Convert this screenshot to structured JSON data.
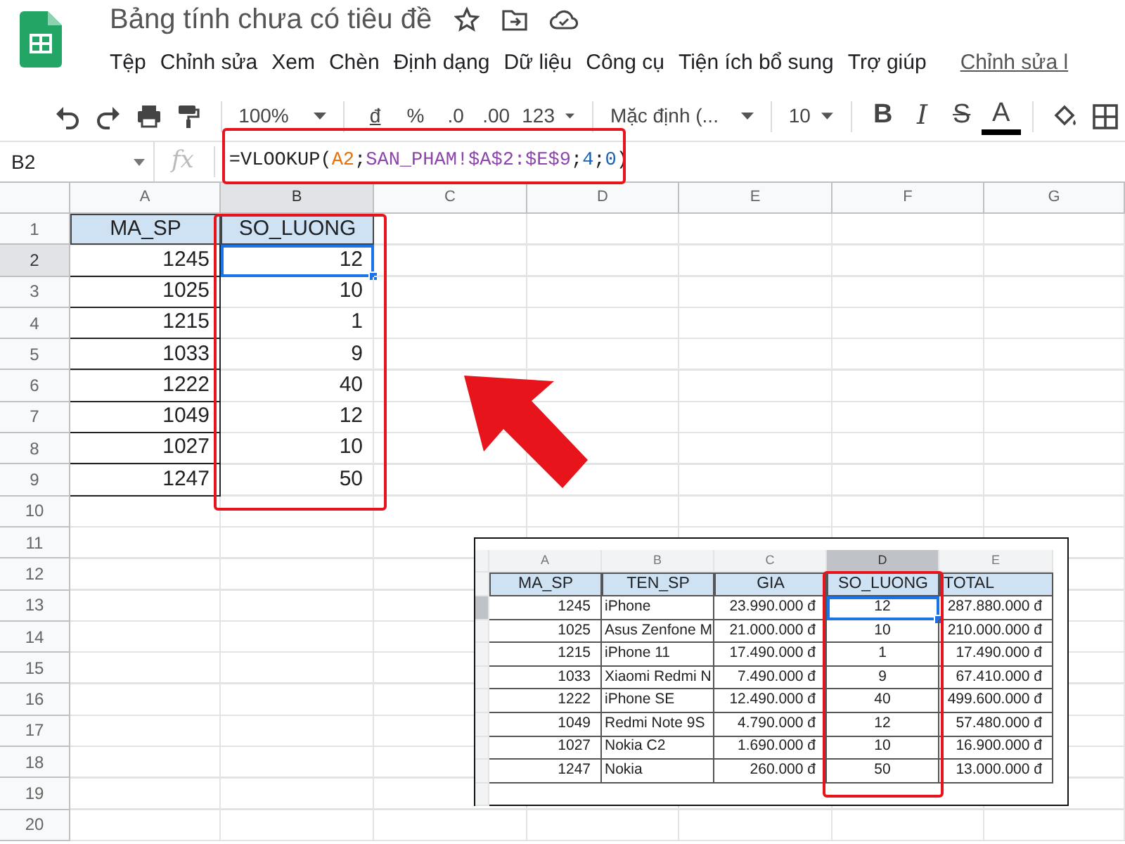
{
  "app": {
    "title": "Bảng tính chưa có tiêu đề",
    "menu": [
      "Tệp",
      "Chỉnh sửa",
      "Xem",
      "Chèn",
      "Định dạng",
      "Dữ liệu",
      "Công cụ",
      "Tiện ích bổ sung",
      "Trợ giúp"
    ],
    "last_edit": "Chỉnh sửa l"
  },
  "toolbar": [
    {
      "kind": "undo"
    },
    {
      "kind": "redo"
    },
    {
      "kind": "print"
    },
    {
      "kind": "paint"
    },
    {
      "kind": "sep"
    },
    {
      "kind": "dropdown",
      "text": "100%"
    },
    {
      "kind": "sep"
    },
    {
      "kind": "text",
      "text": "đ"
    },
    {
      "kind": "text",
      "text": "%"
    },
    {
      "kind": "text",
      "text": ".0"
    },
    {
      "kind": "text",
      "text": ".00"
    },
    {
      "kind": "dropdown",
      "text": "123"
    },
    {
      "kind": "sep"
    },
    {
      "kind": "dropdown",
      "text": "Mặc định (..."
    },
    {
      "kind": "sep"
    },
    {
      "kind": "dropdown",
      "text": "10"
    },
    {
      "kind": "sep"
    },
    {
      "kind": "bold",
      "text": "B"
    },
    {
      "kind": "italic",
      "text": "I"
    },
    {
      "kind": "strike",
      "text": "S"
    },
    {
      "kind": "color",
      "text": "A"
    },
    {
      "kind": "sep"
    },
    {
      "kind": "fill"
    },
    {
      "kind": "borders"
    }
  ],
  "formula_bar": {
    "cell": "B2",
    "fx": "fx",
    "tokens": [
      {
        "text": "=VLOOKUP(",
        "color": "#202124"
      },
      {
        "text": "A2",
        "color": "#e8710a"
      },
      {
        "text": ";",
        "color": "#202124"
      },
      {
        "text": "SAN_PHAM!$A$2:$E$9",
        "color": "#8e44ad"
      },
      {
        "text": ";",
        "color": "#202124"
      },
      {
        "text": "4",
        "color": "#1a5fb4"
      },
      {
        "text": ";",
        "color": "#202124"
      },
      {
        "text": "0",
        "color": "#1a5fb4"
      },
      {
        "text": ")",
        "color": "#202124"
      }
    ]
  },
  "sheet": {
    "columns": [
      {
        "label": "A",
        "selected": false
      },
      {
        "label": "B",
        "selected": true
      },
      {
        "label": "C",
        "selected": false
      },
      {
        "label": "D",
        "selected": false
      },
      {
        "label": "E",
        "selected": false
      },
      {
        "label": "F",
        "selected": false
      },
      {
        "label": "G",
        "selected": false
      }
    ],
    "rows": [
      {
        "number": "1",
        "kind": "header",
        "selected": false,
        "cells": [
          "MA_SP",
          "SO_LUONG"
        ]
      },
      {
        "number": "2",
        "kind": "data",
        "selected": true,
        "cells": [
          "1245",
          "12"
        ]
      },
      {
        "number": "3",
        "kind": "data",
        "selected": false,
        "cells": [
          "1025",
          "10"
        ]
      },
      {
        "number": "4",
        "kind": "data",
        "selected": false,
        "cells": [
          "1215",
          "1"
        ]
      },
      {
        "number": "5",
        "kind": "data",
        "selected": false,
        "cells": [
          "1033",
          "9"
        ]
      },
      {
        "number": "6",
        "kind": "data",
        "selected": false,
        "cells": [
          "1222",
          "40"
        ]
      },
      {
        "number": "7",
        "kind": "data",
        "selected": false,
        "cells": [
          "1049",
          "12"
        ]
      },
      {
        "number": "8",
        "kind": "data",
        "selected": false,
        "cells": [
          "1027",
          "10"
        ]
      },
      {
        "number": "9",
        "kind": "data",
        "selected": false,
        "cells": [
          "1247",
          "50"
        ]
      },
      {
        "number": "10",
        "kind": "empty",
        "selected": false
      },
      {
        "number": "11",
        "kind": "empty",
        "selected": false
      },
      {
        "number": "12",
        "kind": "empty",
        "selected": false
      },
      {
        "number": "13",
        "kind": "empty",
        "selected": false
      },
      {
        "number": "14",
        "kind": "empty",
        "selected": false
      },
      {
        "number": "15",
        "kind": "empty",
        "selected": false
      },
      {
        "number": "16",
        "kind": "empty",
        "selected": false
      },
      {
        "number": "17",
        "kind": "empty",
        "selected": false
      },
      {
        "number": "18",
        "kind": "empty",
        "selected": false
      },
      {
        "number": "19",
        "kind": "empty",
        "selected": false
      },
      {
        "number": "20",
        "kind": "empty",
        "selected": false
      }
    ]
  },
  "inset": {
    "columns": [
      {
        "label": "A",
        "selected": false
      },
      {
        "label": "B",
        "selected": false
      },
      {
        "label": "C",
        "selected": false
      },
      {
        "label": "D",
        "selected": true
      },
      {
        "label": "E",
        "selected": false
      }
    ],
    "rows": [
      {
        "kind": "header",
        "selected": false,
        "cells": [
          "MA_SP",
          "TEN_SP",
          "GIA",
          "SO_LUONG",
          "TOTAL"
        ]
      },
      {
        "kind": "data",
        "selected": true,
        "cells": [
          "1245",
          "iPhone",
          "23.990.000 đ",
          "12",
          "287.880.000 đ"
        ]
      },
      {
        "kind": "data",
        "selected": false,
        "cells": [
          "1025",
          "Asus Zenfone M",
          "21.000.000 đ",
          "10",
          "210.000.000 đ"
        ]
      },
      {
        "kind": "data",
        "selected": false,
        "cells": [
          "1215",
          "iPhone 11",
          "17.490.000 đ",
          "1",
          "17.490.000 đ"
        ]
      },
      {
        "kind": "data",
        "selected": false,
        "cells": [
          "1033",
          "Xiaomi Redmi N",
          "7.490.000 đ",
          "9",
          "67.410.000 đ"
        ]
      },
      {
        "kind": "data",
        "selected": false,
        "cells": [
          "1222",
          "iPhone SE",
          "12.490.000 đ",
          "40",
          "499.600.000 đ"
        ]
      },
      {
        "kind": "data",
        "selected": false,
        "cells": [
          "1049",
          "Redmi Note 9S",
          "4.790.000 đ",
          "12",
          "57.480.000 đ"
        ]
      },
      {
        "kind": "data",
        "selected": false,
        "cells": [
          "1027",
          "Nokia C2",
          "1.690.000 đ",
          "10",
          "16.900.000 đ"
        ]
      },
      {
        "kind": "data",
        "selected": false,
        "cells": [
          "1247",
          "Nokia",
          "260.000 đ",
          "50",
          "13.000.000 đ"
        ]
      }
    ]
  }
}
